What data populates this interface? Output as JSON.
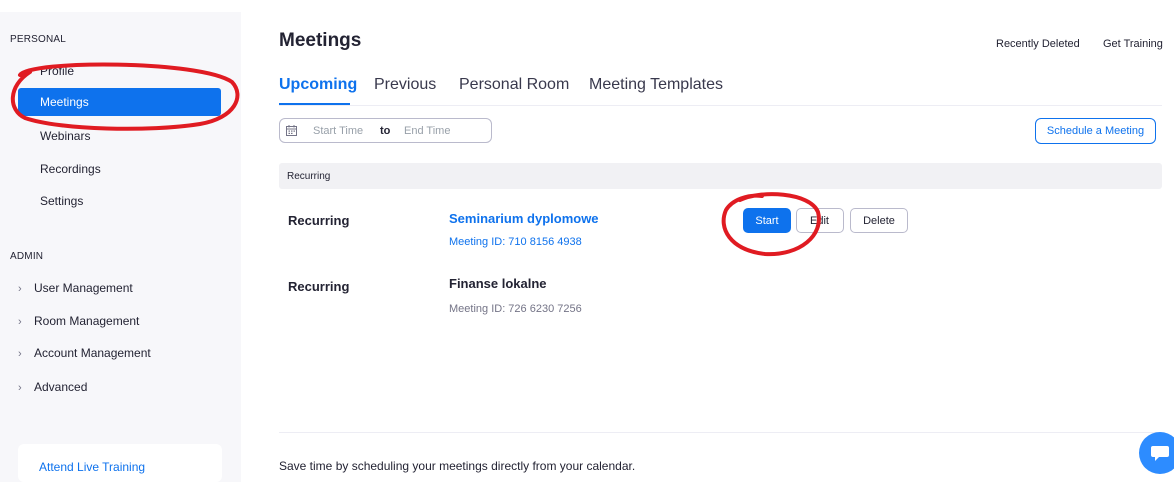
{
  "sidebar": {
    "personal_title": "PERSONAL",
    "items": [
      {
        "label": "Profile",
        "active": false
      },
      {
        "label": "Meetings",
        "active": true
      },
      {
        "label": "Webinars",
        "active": false
      },
      {
        "label": "Recordings",
        "active": false
      },
      {
        "label": "Settings",
        "active": false
      }
    ],
    "admin_title": "ADMIN",
    "admin_items": [
      {
        "label": "User Management"
      },
      {
        "label": "Room Management"
      },
      {
        "label": "Account Management"
      },
      {
        "label": "Advanced"
      }
    ],
    "live_training": "Attend Live Training"
  },
  "header": {
    "title": "Meetings",
    "recently_deleted": "Recently Deleted",
    "get_training": "Get Training"
  },
  "tabs": [
    {
      "label": "Upcoming",
      "active": true
    },
    {
      "label": "Previous",
      "active": false
    },
    {
      "label": "Personal Room",
      "active": false
    },
    {
      "label": "Meeting Templates",
      "active": false
    }
  ],
  "filter": {
    "start_placeholder": "Start Time",
    "to": "to",
    "end_placeholder": "End Time",
    "schedule_button": "Schedule a Meeting"
  },
  "group_label": "Recurring",
  "meetings": [
    {
      "type": "Recurring",
      "topic": "Seminarium dyplomowe",
      "id": "Meeting ID: 710 8156 4938",
      "start": "Start",
      "edit": "Edit",
      "delete": "Delete"
    },
    {
      "type": "Recurring",
      "topic": "Finanse lokalne",
      "id": "Meeting ID: 726 6230 7256"
    }
  ],
  "footer": {
    "calendar_text": "Save time by scheduling your meetings directly from your calendar."
  },
  "colors": {
    "accent": "#0e72ed",
    "annotation": "#e01b22"
  }
}
